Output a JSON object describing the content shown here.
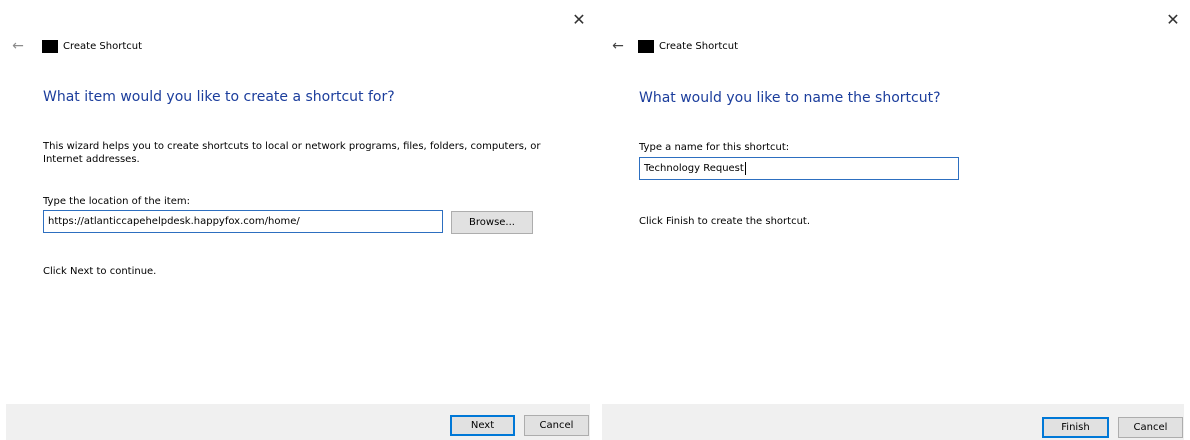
{
  "wizard1": {
    "title": "Create Shortcut",
    "heading": "What item would you like to create a shortcut for?",
    "intro_line1": "This wizard helps you to create shortcuts to local or network programs, files, folders, computers, or",
    "intro_line2": "Internet addresses.",
    "location_label": "Type the location of the item:",
    "location_value": "https://atlanticcapehelpdesk.happyfox.com/home/",
    "browse_label": "Browse...",
    "continue_text": "Click Next to continue.",
    "next_label": "Next",
    "cancel_label": "Cancel",
    "close_glyph": "✕",
    "back_glyph": "←"
  },
  "wizard2": {
    "title": "Create Shortcut",
    "heading": "What would you like to name the shortcut?",
    "name_label": "Type a name for this shortcut:",
    "name_value": "Technology Request",
    "finish_text": "Click Finish to create the shortcut.",
    "finish_label": "Finish",
    "cancel_label": "Cancel",
    "close_glyph": "✕",
    "back_glyph": "←"
  }
}
